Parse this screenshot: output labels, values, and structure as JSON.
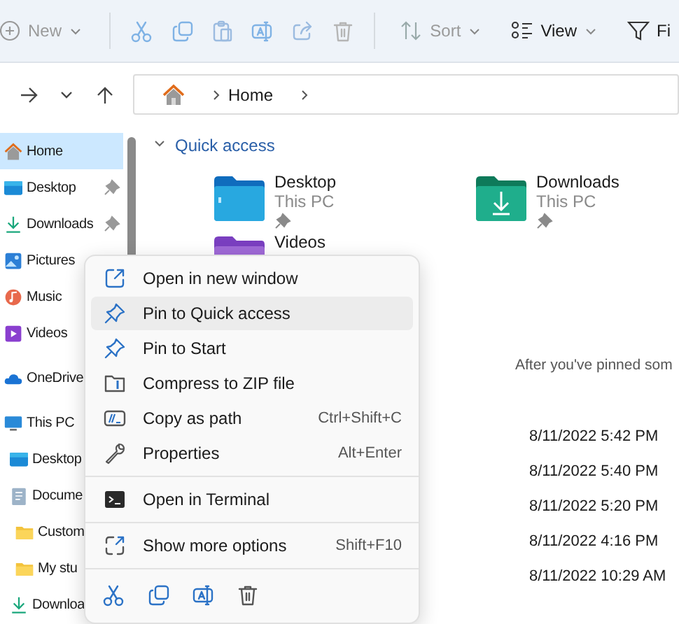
{
  "toolbar": {
    "buttons": [
      {
        "label": "New",
        "kind": "new",
        "disabled": true
      },
      {
        "label": "Sort",
        "kind": "sort",
        "disabled": true
      },
      {
        "label": "View",
        "kind": "view",
        "disabled": false
      },
      {
        "label": "Fi",
        "kind": "filter",
        "disabled": false
      }
    ]
  },
  "address_bar": {
    "path": [
      "Home"
    ]
  },
  "sidebar": {
    "sections": [
      {
        "items": [
          {
            "label": "Home",
            "kind": "home",
            "selected": true,
            "pinned": false
          },
          {
            "label": "Desktop",
            "kind": "desktop",
            "selected": false,
            "pinned": true
          },
          {
            "label": "Downloads",
            "kind": "downloads",
            "selected": false,
            "pinned": true
          },
          {
            "label": "Pictures",
            "kind": "pictures",
            "selected": false
          },
          {
            "label": "Music",
            "kind": "music",
            "selected": false
          },
          {
            "label": "Videos",
            "kind": "videos",
            "selected": false
          }
        ]
      },
      {
        "items": [
          {
            "label": "OneDrive",
            "kind": "cloud",
            "selected": false
          }
        ]
      },
      {
        "items": [
          {
            "label": "This PC",
            "kind": "pc",
            "selected": false,
            "children": [
              {
                "label": "Desktop",
                "kind": "desktop",
                "selected": false
              },
              {
                "label": "Docume",
                "kind": "documents",
                "selected": false,
                "children": [
                  {
                    "label": "Custom",
                    "kind": "folder",
                    "selected": false
                  },
                  {
                    "label": "My stu",
                    "kind": "folder",
                    "selected": false
                  }
                ]
              },
              {
                "label": "Downloa",
                "kind": "downloads",
                "selected": false
              }
            ]
          }
        ]
      }
    ]
  },
  "quick_access": {
    "title": "Quick access",
    "expanded": true,
    "tiles": [
      {
        "name": "Desktop",
        "location": "This PC",
        "kind": "desktop"
      },
      {
        "name": "Downloads",
        "location": "This PC",
        "kind": "downloads"
      },
      {
        "name": "Videos",
        "kind": "videos"
      }
    ]
  },
  "recent": {
    "empty_message": "After you've pinned som",
    "dates": [
      "8/11/2022 5:42 PM",
      "8/11/2022 5:40 PM",
      "8/11/2022 5:20 PM",
      "8/11/2022 4:16 PM",
      "8/11/2022 10:29 AM"
    ]
  },
  "context_menu": {
    "groups": [
      [
        {
          "label": "Open in new window",
          "kind": "open-window",
          "selected": false
        },
        {
          "label": "Pin to Quick access",
          "kind": "pin",
          "selected": true
        },
        {
          "label": "Pin to Start",
          "kind": "pin",
          "selected": false
        },
        {
          "label": "Compress to ZIP file",
          "kind": "zip",
          "selected": false
        },
        {
          "label": "Copy as path",
          "kind": "path",
          "shortcut": "Ctrl+Shift+C",
          "selected": false
        },
        {
          "label": "Properties",
          "kind": "wrench",
          "shortcut": "Alt+Enter",
          "selected": false
        }
      ],
      [
        {
          "label": "Open in Terminal",
          "kind": "terminal",
          "selected": false
        }
      ],
      [
        {
          "label": "Show more options",
          "kind": "more",
          "shortcut": "Shift+F10",
          "selected": false
        }
      ]
    ]
  }
}
